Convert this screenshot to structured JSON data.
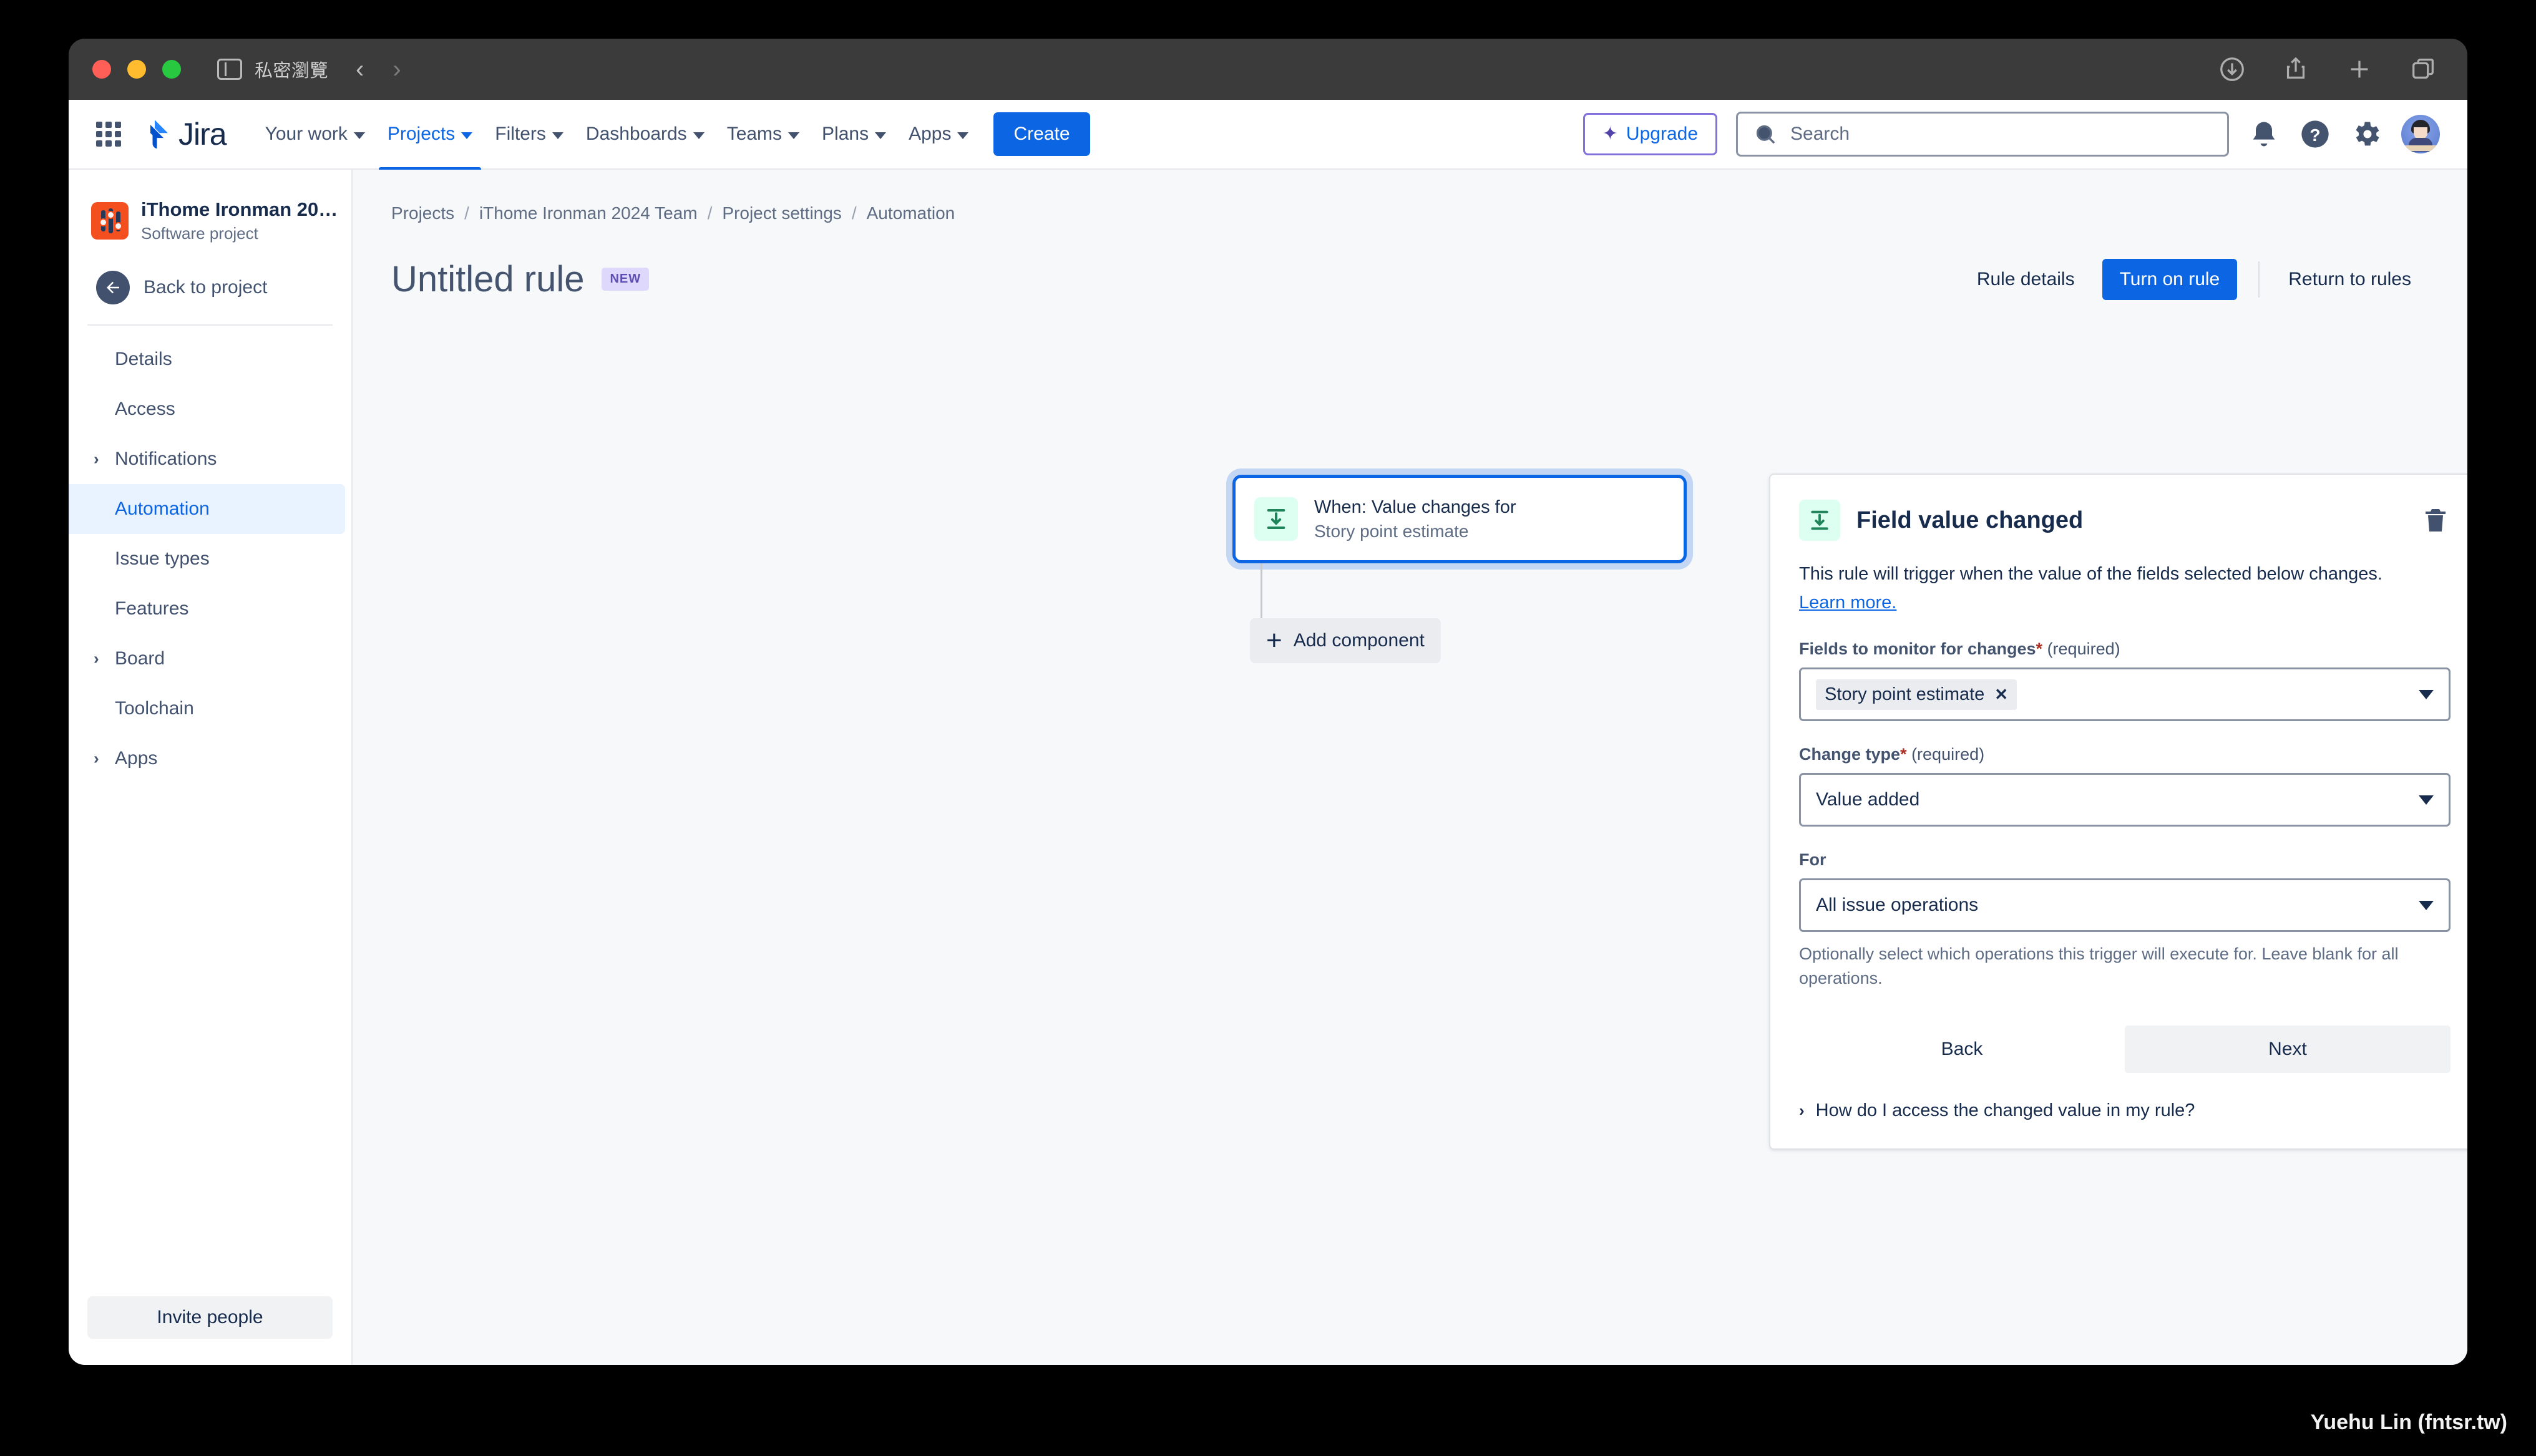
{
  "browser": {
    "private_label": "私密瀏覽",
    "nav_back_icon": "chevron-left-icon",
    "nav_forward_icon": "chevron-right-icon",
    "toolbar_icons": [
      "downloads-icon",
      "share-icon",
      "new-tab-icon",
      "tab-overview-icon"
    ]
  },
  "topnav": {
    "app_switcher_icon": "app-switcher-icon",
    "logo_text": "Jira",
    "items": [
      {
        "label": "Your work",
        "has_caret": true,
        "active": false
      },
      {
        "label": "Projects",
        "has_caret": true,
        "active": true
      },
      {
        "label": "Filters",
        "has_caret": true,
        "active": false
      },
      {
        "label": "Dashboards",
        "has_caret": true,
        "active": false
      },
      {
        "label": "Teams",
        "has_caret": true,
        "active": false
      },
      {
        "label": "Plans",
        "has_caret": true,
        "active": false
      },
      {
        "label": "Apps",
        "has_caret": true,
        "active": false
      }
    ],
    "create_label": "Create",
    "upgrade_label": "Upgrade",
    "search_placeholder": "Search",
    "search_value": "",
    "icons": [
      "notifications-bell-icon",
      "help-icon",
      "settings-gear-icon",
      "user-avatar"
    ],
    "accent_color": "#0c66e4",
    "upgrade_border_color": "#8270db"
  },
  "sidebar": {
    "project_name": "iThome Ironman 2024 ...",
    "project_type": "Software project",
    "project_icon_color": "#f4501f",
    "back_label": "Back to project",
    "items": [
      {
        "label": "Details",
        "expandable": false,
        "active": false
      },
      {
        "label": "Access",
        "expandable": false,
        "active": false
      },
      {
        "label": "Notifications",
        "expandable": true,
        "active": false
      },
      {
        "label": "Automation",
        "expandable": false,
        "active": true
      },
      {
        "label": "Issue types",
        "expandable": false,
        "active": false
      },
      {
        "label": "Features",
        "expandable": false,
        "active": false
      },
      {
        "label": "Board",
        "expandable": true,
        "active": false
      },
      {
        "label": "Toolchain",
        "expandable": false,
        "active": false
      },
      {
        "label": "Apps",
        "expandable": true,
        "active": false
      }
    ],
    "invite_label": "Invite people"
  },
  "breadcrumb": {
    "items": [
      "Projects",
      "iThome Ironman 2024 Team",
      "Project settings",
      "Automation"
    ],
    "separator": "/"
  },
  "page": {
    "title": "Untitled rule",
    "badge": "NEW",
    "actions": {
      "rule_details": "Rule details",
      "turn_on_rule": "Turn on rule",
      "return_to_rules": "Return to rules"
    }
  },
  "canvas": {
    "trigger": {
      "icon": "field-value-changed-icon",
      "title": "When: Value changes for",
      "subtitle": "Story point estimate"
    },
    "add_component_label": "Add component",
    "add_component_icon": "plus-icon"
  },
  "config_panel": {
    "icon": "field-value-changed-icon",
    "title": "Field value changed",
    "delete_icon": "trash-icon",
    "description": "This rule will trigger when the value of the fields selected below changes.",
    "learn_more": "Learn more.",
    "fields_label": "Fields to monitor for changes",
    "fields_required_marker": "*",
    "fields_required_text": "(required)",
    "fields_chip": "Story point estimate",
    "fields_chip_remove": "✕",
    "change_type_label": "Change type",
    "change_type_required_marker": "*",
    "change_type_required_text": "(required)",
    "change_type_value": "Value added",
    "for_label": "For",
    "for_value": "All issue operations",
    "for_helper": "Optionally select which operations this trigger will execute for. Leave blank for all operations.",
    "back_label": "Back",
    "next_label": "Next",
    "expand_question": "How do I access the changed value in my rule?"
  },
  "watermark": "Yuehu Lin (fntsr.tw)"
}
